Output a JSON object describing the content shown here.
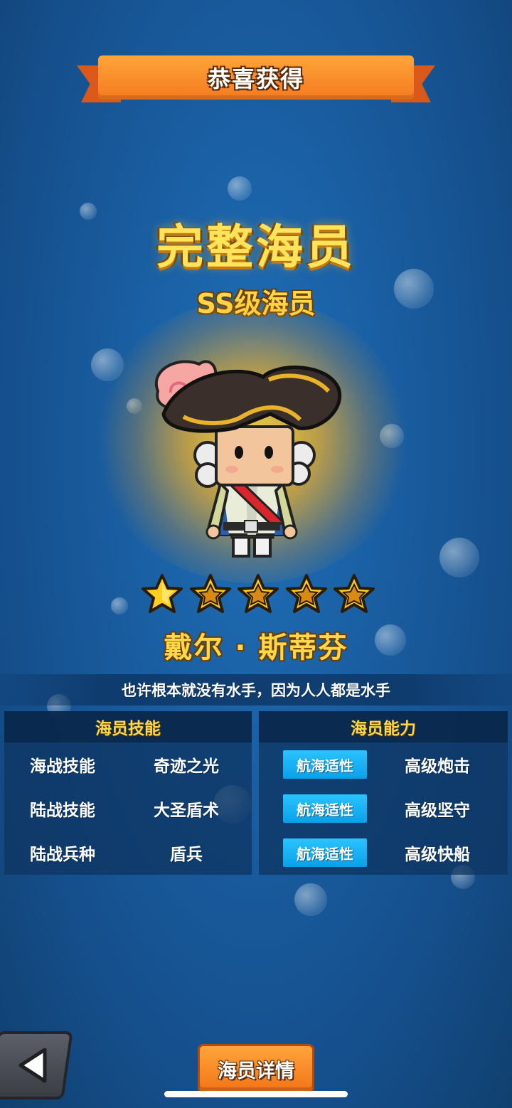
{
  "banner": {
    "title": "恭喜获得"
  },
  "headline": "完整海员",
  "rank": "SS级海员",
  "character": {
    "stars": 5,
    "name": "戴尔 · 斯蒂芬",
    "quote": "也许根本就没有水手，因为人人都是水手"
  },
  "skills_panel": {
    "title": "海员技能",
    "rows": [
      {
        "key": "海战技能",
        "value": "奇迹之光"
      },
      {
        "key": "陆战技能",
        "value": "大圣盾术"
      },
      {
        "key": "陆战兵种",
        "value": "盾兵"
      }
    ]
  },
  "ability_panel": {
    "title": "海员能力",
    "rows": [
      {
        "tag": "航海适性",
        "value": "高级炮击"
      },
      {
        "tag": "航海适性",
        "value": "高级坚守"
      },
      {
        "tag": "航海适性",
        "value": "高级快船"
      }
    ]
  },
  "buttons": {
    "detail": "海员详情"
  },
  "icons": {
    "back": "back-arrow-icon",
    "star": "star-icon"
  },
  "colors": {
    "accent": "#ffd84a",
    "banner": "#f47a1e",
    "tag": "#15b0f5"
  }
}
